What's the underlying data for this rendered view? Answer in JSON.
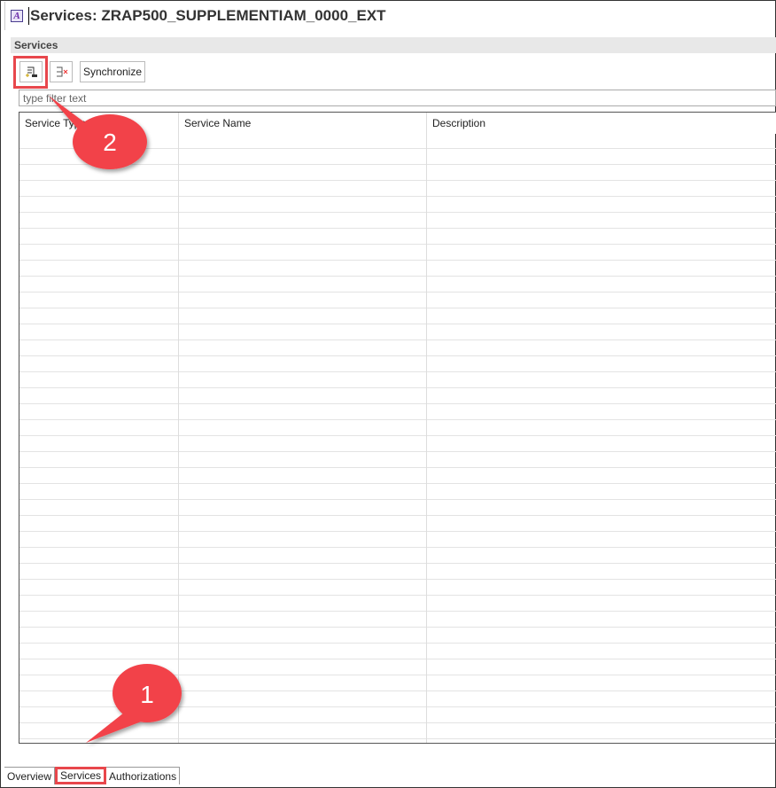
{
  "editor": {
    "title": "Services: ZRAP500_SUPPLEMENTIAM_0000_EXT",
    "icon": "app-descriptor-icon"
  },
  "section": {
    "title": "Services"
  },
  "toolbar": {
    "add_icon": "add-service-icon",
    "remove_icon": "remove-service-icon",
    "synchronize_label": "Synchronize"
  },
  "filter": {
    "placeholder": "type filter text"
  },
  "table": {
    "columns": [
      "Service Type",
      "Service Name",
      "Description"
    ],
    "rows": []
  },
  "tabs": [
    "Overview",
    "Services",
    "Authorizations"
  ],
  "callouts": [
    "1",
    "2"
  ],
  "colors": {
    "callout": "#f2434a"
  }
}
